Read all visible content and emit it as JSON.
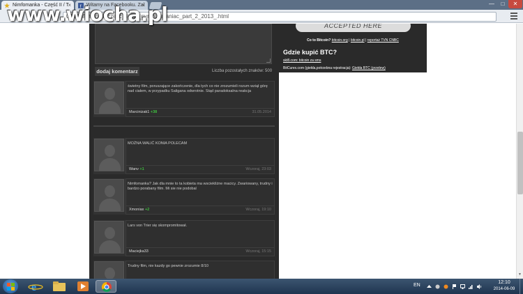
{
  "watermark": "www.wiocha.pl",
  "browser": {
    "tabs": [
      {
        "title": "Nimfomanka - Część II / T",
        "close": "×"
      },
      {
        "title": "Witamy na Facebooku. Zal",
        "close": "×"
      }
    ],
    "url_host": "",
    "url_path": "08/nimfomanka_czesc_ii_the_nymphomaniac_part_2_2013_.html",
    "window_buttons": {
      "minimize": "—",
      "maximize": "□",
      "close": "✕"
    }
  },
  "comment_form": {
    "submit_label": "dodaj komentarz",
    "chars_left": "Liczba pozostałych znaków: 500"
  },
  "comments": [
    {
      "text": "świetny film, poruszające zakończenie, dla tych co nie zrozumieli rozum wziął górę nad ciałem, w przypadku Saligana odwrotnie. Stąd paradoksalna reakcja",
      "author": "Marcinizak1",
      "score": "+38",
      "date": "31.05.2014"
    },
    {
      "text": "MOŻNA WALIĆ KONIA POLECAM",
      "author": "Wanv",
      "score": "+1",
      "date": "Wczoraj, 23:03"
    },
    {
      "text": "Nimfomanka? Jak dla mnie to ta kobieta ma wsciekliżne macicy. Zwariowany, trudny i bardzo porabany film. Mi sie nie podobal",
      "author": "Xmoniax",
      "score": "+2",
      "date": "Wczoraj, 19:10"
    },
    {
      "text": "Lars von Trier się skompromitował.",
      "author": "Maciejka33",
      "score": "",
      "date": "Wczoraj, 15:15"
    },
    {
      "text": "Trudny film, nie kazdy go pewnie zrozumie 8/10",
      "author": "",
      "score": "",
      "date": ""
    }
  ],
  "sidebar": {
    "accepted_text": "ACCEPTED HERE",
    "bitcoin_prefix": "Co to Bitcoin?",
    "bitcoin_links": [
      "bitcoin.org",
      "bitcoin.pl",
      "reportaż TVN CNBC"
    ],
    "separator": "|",
    "where_buy": "Gdzie kupić BTC?",
    "exchange1": "skt8.com: bitcoin za sms",
    "exchange2_prefix": "BitCurex.com (giełda,potrzebna rejestracja):",
    "exchange2_link": "Giełda BTC (przelew)"
  },
  "taskbar": {
    "language": "EN",
    "time": "12:10",
    "date": "2014-06-09",
    "icons": [
      "windows-start-icon",
      "internet-explorer-icon",
      "folder-icon",
      "media-player-icon",
      "chrome-icon"
    ]
  },
  "colors": {
    "page_bg": "#2a2a2a",
    "score_green": "#3fbf3f",
    "tab_bar": "#5c6f86"
  }
}
